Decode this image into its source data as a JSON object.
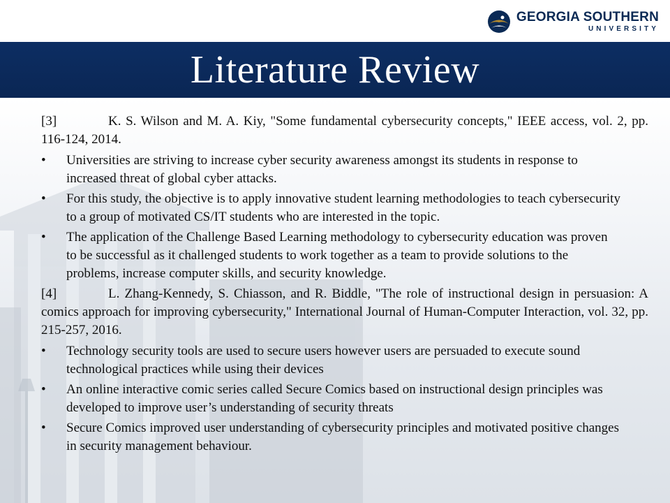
{
  "header": {
    "logo_line1": "GEORGIA SOUTHERN",
    "logo_line2": "UNIVERSITY",
    "logo_icon": "eagle-icon"
  },
  "title": "Literature Review",
  "bullet_glyph": "•",
  "references": [
    {
      "number": "[3]",
      "citation": "K. S. Wilson and M. A. Kiy, \"Some fundamental cybersecurity concepts,\" IEEE access, vol. 2, pp. 116-124, 2014.",
      "bullets": [
        "Universities are striving to increase cyber security awareness amongst its students in response to increased threat of global cyber attacks.",
        "For this study, the objective is to apply innovative student learning methodologies to teach cybersecurity to a group of motivated CS/IT students who are interested in the topic.",
        "The application of the Challenge Based Learning methodology to cybersecurity education was proven to be successful as it challenged students to work together as a team to provide solutions to the problems, increase computer skills, and security knowledge."
      ]
    },
    {
      "number": "[4]",
      "citation": "L. Zhang-Kennedy, S. Chiasson, and R. Biddle, \"The role of instructional design in persuasion: A comics approach for improving cybersecurity,\" International Journal of Human-Computer Interaction, vol. 32, pp. 215-257, 2016.",
      "bullets": [
        "Technology security tools are used to secure users however users are persuaded to execute sound technological practices while using their devices",
        "An online interactive comic series called Secure Comics based on instructional design principles was developed to improve user’s understanding of security threats",
        "Secure Comics improved user understanding of cybersecurity principles and motivated positive changes in security management behaviour."
      ]
    }
  ],
  "colors": {
    "banner": "#0b2a5a",
    "title_text": "#ffffff",
    "body_text": "#111111",
    "logo_navy": "#0b2a55",
    "logo_gold": "#b58a2e"
  }
}
